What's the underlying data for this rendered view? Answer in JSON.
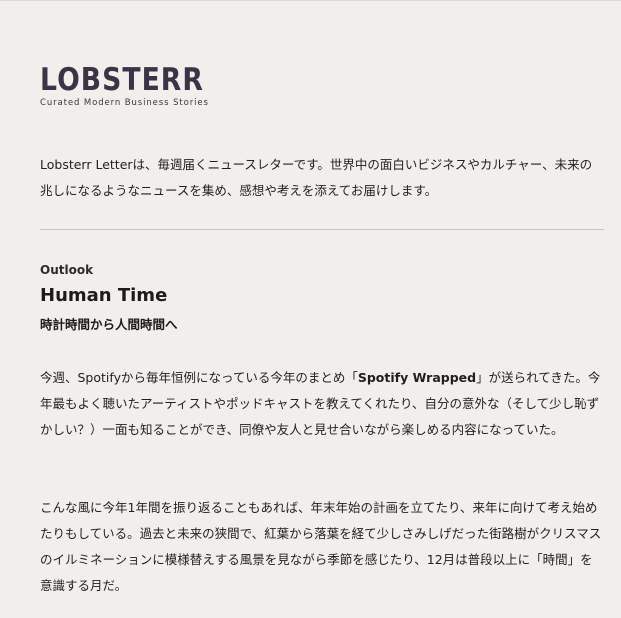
{
  "logo": {
    "title": "LOBSTERR",
    "tagline": "Curated Modern Business Stories"
  },
  "intro": {
    "text": "Lobsterr Letterは、毎週届くニュースレターです。世界中の面白いビジネスやカルチャー、未来の兆しになるようなニュースを集め、感想や考えを添えてお届けします。"
  },
  "article": {
    "section": "Outlook",
    "title": "Human Time",
    "subtitle": "時計時間から人間時間へ",
    "para1_before": "今週、Spotifyから毎年恒例になっている今年のまとめ「",
    "para1_bold": "Spotify Wrapped",
    "para1_after": "」が送られてきた。今年最もよく聴いたアーティストやポッドキャストを教えてくれたり、自分の意外な（そして少し恥ずかしい？）一面も知ることができ、同僚や友人と見せ合いながら楽しめる内容になっていた。",
    "para2": "こんな風に今年1年間を振り返ることもあれば、年末年始の計画を立てたり、来年に向けて考え始めたりもしている。過去と未来の狭間で、紅葉から落葉を経て少しさみしげだった街路樹がクリスマスのイルミネーションに模様替えする風景を見ながら季節を感じたり、12月は普段以上に「時間」を意識する月だ。"
  }
}
